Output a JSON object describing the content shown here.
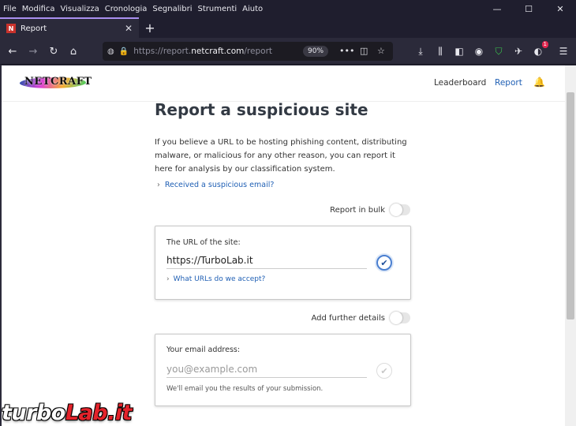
{
  "menu": [
    "File",
    "Modifica",
    "Visualizza",
    "Cronologia",
    "Segnalibri",
    "Strumenti",
    "Aiuto"
  ],
  "window_controls": {
    "minimize": "—",
    "maximize": "☐",
    "close": "✕"
  },
  "tab": {
    "title": "Report",
    "favicon_letter": "N",
    "close": "✕"
  },
  "new_tab": "+",
  "urlbar": {
    "prefix": "https://report.",
    "domain": "netcraft.com",
    "path": "/report",
    "zoom": "90%"
  },
  "site": {
    "logo": "NETCRAFT",
    "nav": {
      "leaderboard": "Leaderboard",
      "report": "Report"
    }
  },
  "page": {
    "title": "Report a suspicious site",
    "intro": "If you believe a URL to be hosting phishing content, distributing malware, or malicious for any other reason, you can report it here for analysis by our classification system.",
    "email_link": "Received a suspicious email?",
    "bulk_label": "Report in bulk",
    "url_card": {
      "label": "The URL of the site:",
      "value": "https://TurboLab.it",
      "help_link": "What URLs do we accept?"
    },
    "details_label": "Add further details",
    "email_card": {
      "label": "Your email address:",
      "placeholder": "you@example.com",
      "note": "We'll email you the results of your submission."
    }
  },
  "extension_badge": "1",
  "watermark": {
    "part1": "turbo",
    "part2": "Lab.it"
  }
}
